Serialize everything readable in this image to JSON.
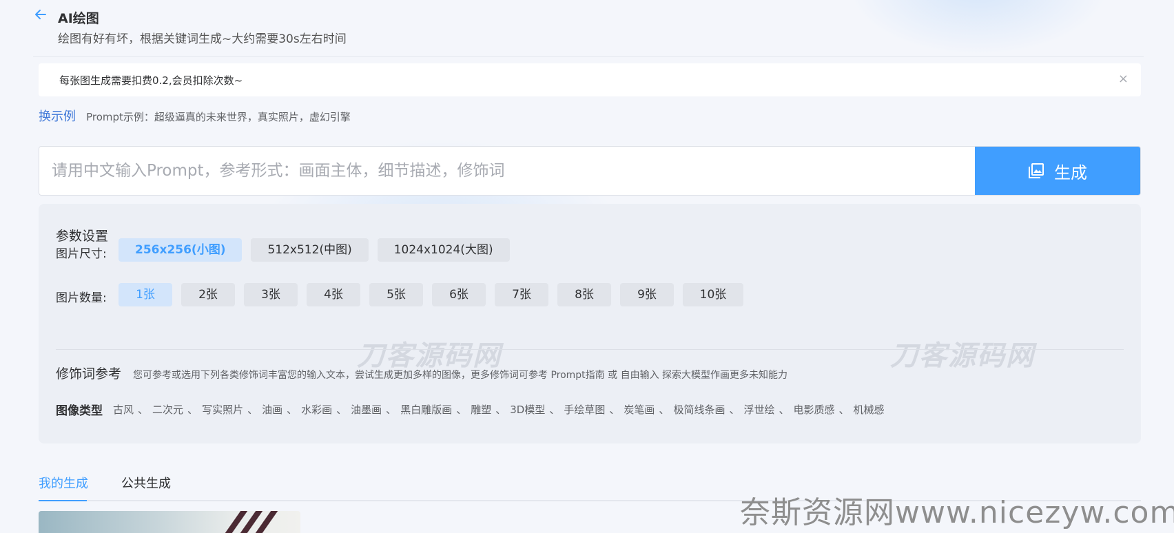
{
  "header": {
    "title": "AI绘图",
    "subtitle": "绘图有好有坏，根据关键词生成~大约需要30s左右时间"
  },
  "notice": {
    "text": "每张图生成需要扣费0.2,会员扣除次数~",
    "close_label": "×"
  },
  "example": {
    "change_label": "换示例",
    "prompt_text": "Prompt示例：超级逼真的未来世界，真实照片，虚幻引擎"
  },
  "prompt": {
    "placeholder": "请用中文输入Prompt，参考形式：画面主体，细节描述，修饰词",
    "value": "",
    "generate_label": "生成"
  },
  "params": {
    "title": "参数设置",
    "size_label": "图片尺寸:",
    "sizes": [
      "256x256(小图)",
      "512x512(中图)",
      "1024x1024(大图)"
    ],
    "selected_size": "256x256(小图)",
    "count_label": "图片数量:",
    "counts": [
      "1张",
      "2张",
      "3张",
      "4张",
      "5张",
      "6张",
      "7张",
      "8张",
      "9张",
      "10张"
    ],
    "selected_count": "1张"
  },
  "watermarks": [
    "刀客源码网",
    "刀客源码网"
  ],
  "modifiers": {
    "title": "修饰词参考",
    "description": "您可参考或选用下列各类修饰词丰富您的输入文本，尝试生成更加多样的图像，更多修饰词可参考 Prompt指南 或 自由输入 探索大模型作画更多未知能力",
    "style_label": "图像类型",
    "separator": "、",
    "styles": [
      "古风",
      "二次元",
      "写实照片",
      "油画",
      "水彩画",
      "油墨画",
      "黑白雕版画",
      "雕塑",
      "3D模型",
      "手绘草图",
      "炭笔画",
      "极简线条画",
      "浮世绘",
      "电影质感",
      "机械感"
    ]
  },
  "tabs": [
    {
      "label": "我的生成",
      "active": true
    },
    {
      "label": "公共生成",
      "active": false
    }
  ],
  "site_watermark": "奈斯资源网www.nicezyw.com",
  "colors": {
    "accent": "#409eff",
    "link": "#3f78d8",
    "background": "#f4f6fb",
    "panel": "#eceff5",
    "selected_bg": "#d3e5fb"
  },
  "icons": {
    "back": "arrow-left-icon",
    "generate": "picture-icon",
    "close": "close-icon"
  }
}
